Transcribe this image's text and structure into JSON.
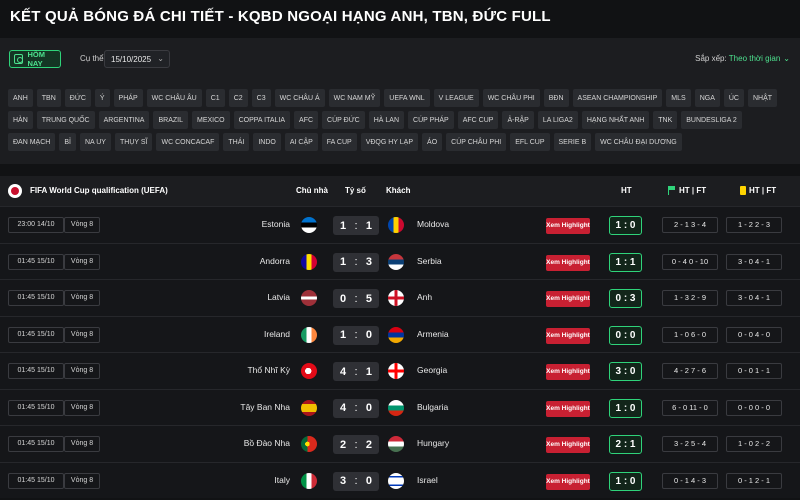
{
  "page_title": "KẾT QUẢ BÓNG ĐÁ CHI TIẾT - KQBD NGOẠI HẠNG ANH, TBN, ĐỨC FULL",
  "filters": {
    "today_label": "HÔM NAY",
    "date_label": "Cụ thể",
    "date_value": "15/10/2025",
    "sort_label": "Sắp xếp:",
    "sort_value": "Theo thời gian"
  },
  "leagues": [
    "ANH",
    "TBN",
    "ĐỨC",
    "Ý",
    "PHÁP",
    "WC CHÂU ÂU",
    "C1",
    "C2",
    "C3",
    "WC CHÂU Á",
    "WC NAM MỸ",
    "UEFA WNL",
    "V LEAGUE",
    "WC CHÂU PHI",
    "BĐN",
    "ASEAN CHAMPIONSHIP",
    "MLS",
    "NGA",
    "ÚC",
    "NHẬT",
    "HÀN",
    "TRUNG QUỐC",
    "ARGENTINA",
    "BRAZIL",
    "MEXICO",
    "COPPA ITALIA",
    "AFC",
    "CÚP ĐỨC",
    "HÀ LAN",
    "CÚP PHÁP",
    "AFC CUP",
    "Ả-RẬP",
    "LA LIGA2",
    "HẠNG NHẤT ANH",
    "TNK",
    "BUNDESLIGA 2",
    "ĐAN MẠCH",
    "BỈ",
    "NA UY",
    "THỤY SĨ",
    "WC CONCACAF",
    "THÁI",
    "INDO",
    "AI CẬP",
    "FA CUP",
    "VĐQG HY LẠP",
    "ÁO",
    "CÚP CHÂU PHI",
    "EFL CUP",
    "SERIE B",
    "WC CHÂU ĐẠI DƯƠNG"
  ],
  "table": {
    "competition": "FIFA World Cup qualification (UEFA)",
    "col_home": "Chủ nhà",
    "col_score": "Tỷ số",
    "col_away": "Khách",
    "col_ht": "HT",
    "col_corner": "HT | FT",
    "col_card": "HT | FT",
    "highlight_label": "Xem Highlight"
  },
  "matches": [
    {
      "time": "23:00 14/10",
      "round": "Vòng 8",
      "home": "Estonia",
      "home_flag": "estonia",
      "home_score": "1",
      "away_score": "1",
      "away": "Moldova",
      "away_flag": "moldova",
      "ht": "1 : 0",
      "corners": "2 - 1   3 - 4",
      "cards": "1 - 2   2 - 3"
    },
    {
      "time": "01:45 15/10",
      "round": "Vòng 8",
      "home": "Andorra",
      "home_flag": "andorra",
      "home_score": "1",
      "away_score": "3",
      "away": "Serbia",
      "away_flag": "serbia",
      "ht": "1 : 1",
      "corners": "0 - 4   0 - 10",
      "cards": "3 - 0   4 - 1"
    },
    {
      "time": "01:45 15/10",
      "round": "Vòng 8",
      "home": "Latvia",
      "home_flag": "latvia",
      "home_score": "0",
      "away_score": "5",
      "away": "Anh",
      "away_flag": "england",
      "ht": "0 : 3",
      "corners": "1 - 3   2 - 9",
      "cards": "3 - 0   4 - 1"
    },
    {
      "time": "01:45 15/10",
      "round": "Vòng 8",
      "home": "Ireland",
      "home_flag": "ireland",
      "home_score": "1",
      "away_score": "0",
      "away": "Armenia",
      "away_flag": "armenia",
      "ht": "0 : 0",
      "corners": "1 - 0   6 - 0",
      "cards": "0 - 0   4 - 0"
    },
    {
      "time": "01:45 15/10",
      "round": "Vòng 8",
      "home": "Thổ Nhĩ Kỳ",
      "home_flag": "turkey",
      "home_score": "4",
      "away_score": "1",
      "away": "Georgia",
      "away_flag": "georgia",
      "ht": "3 : 0",
      "corners": "4 - 2   7 - 6",
      "cards": "0 - 0   1 - 1"
    },
    {
      "time": "01:45 15/10",
      "round": "Vòng 8",
      "home": "Tây Ban Nha",
      "home_flag": "spain",
      "home_score": "4",
      "away_score": "0",
      "away": "Bulgaria",
      "away_flag": "bulgaria",
      "ht": "1 : 0",
      "corners": "6 - 0   11 - 0",
      "cards": "0 - 0   0 - 0"
    },
    {
      "time": "01:45 15/10",
      "round": "Vòng 8",
      "home": "Bồ Đào Nha",
      "home_flag": "portugal",
      "home_score": "2",
      "away_score": "2",
      "away": "Hungary",
      "away_flag": "hungary",
      "ht": "2 : 1",
      "corners": "3 - 2   5 - 4",
      "cards": "1 - 0   2 - 2"
    },
    {
      "time": "01:45 15/10",
      "round": "Vòng 8",
      "home": "Italy",
      "home_flag": "italy",
      "home_score": "3",
      "away_score": "0",
      "away": "Israel",
      "away_flag": "israel",
      "ht": "1 : 0",
      "corners": "0 - 1   4 - 3",
      "cards": "0 - 1   2 - 1"
    }
  ]
}
